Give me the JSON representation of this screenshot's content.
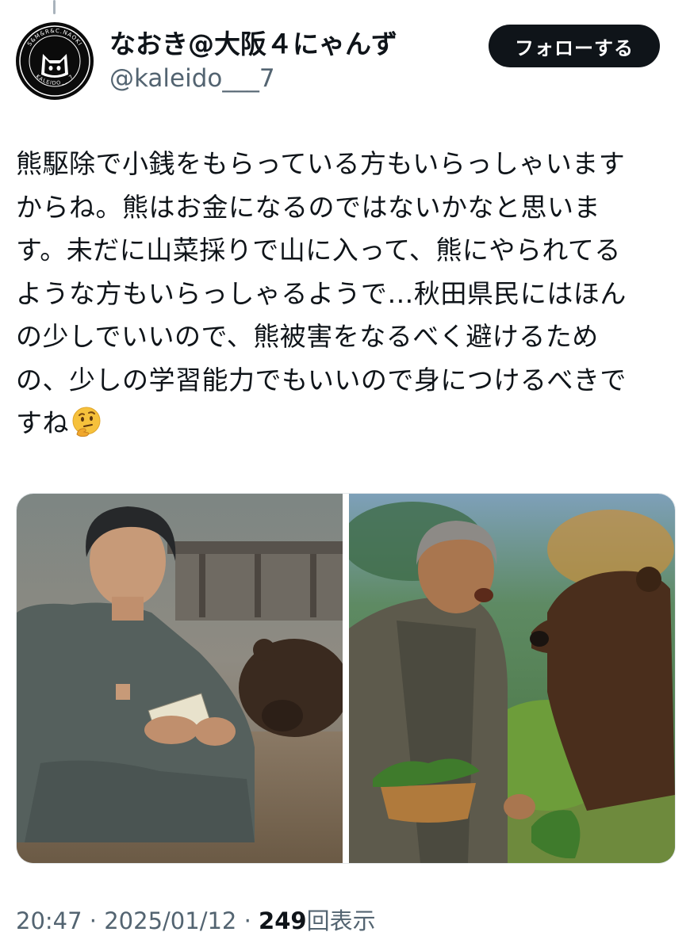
{
  "user": {
    "display_name": "なおき@大阪４にゃんず",
    "handle": "@kaleido___7",
    "avatar_ring_text_top": "S&M&R&C.NAOKI",
    "avatar_ring_text_bottom": "KALEIDO___7"
  },
  "follow_button": {
    "label": "フォローする"
  },
  "tweet": {
    "lines": [
      "熊駆除で小銭をもらっている方もいらっしゃいます",
      "からね。熊はお金になるのではないかなと思いま",
      "す。未だに山菜採りで山に入って、熊にやられてる",
      "ような方もいらっしゃるようで…秋田県民にはほん",
      "の少しでいいので、熊被害をなるべく避けるため",
      "の、少しの学習能力でもいいので身につけるべきで",
      "すね"
    ],
    "emoji": "thinking-face"
  },
  "media": [
    {
      "icon": "man-with-banknote-and-bear-photo"
    },
    {
      "icon": "man-with-vegetable-basket-and-bear-photo"
    }
  ],
  "meta": {
    "time": "20:47",
    "separator": "·",
    "date": "2025/01/12",
    "views_count": "249",
    "views_label": "回表示"
  },
  "colors": {
    "text_primary": "#0f1419",
    "text_secondary": "#536471",
    "button_bg": "#0f1419",
    "button_text": "#ffffff"
  }
}
